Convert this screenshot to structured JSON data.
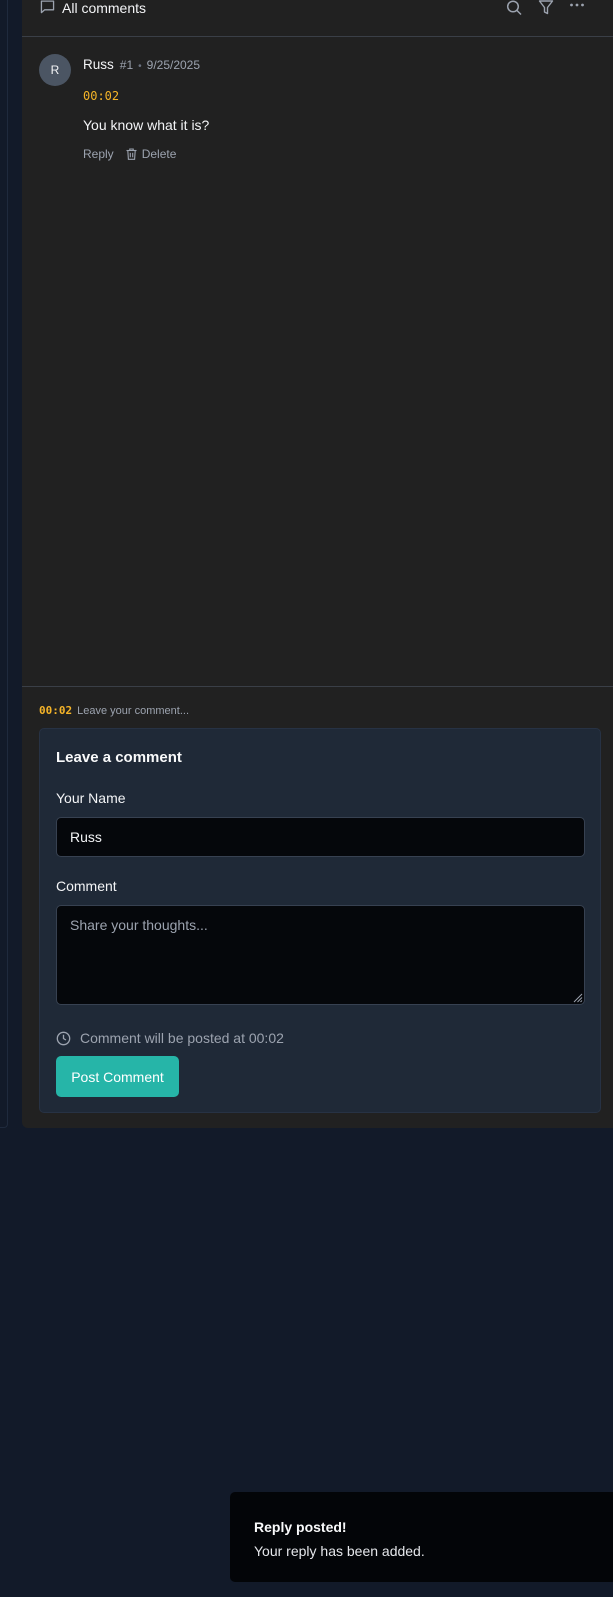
{
  "header": {
    "title": "All comments",
    "icons": [
      "chat-icon",
      "search-icon",
      "filter-icon",
      "more-icon"
    ]
  },
  "comments": [
    {
      "avatar_initial": "R",
      "author": "Russ",
      "number": "#1",
      "separator": "•",
      "date": "9/25/2025",
      "timestamp": "00:02",
      "text": "You know what it is?",
      "actions": {
        "reply": "Reply",
        "delete": "Delete"
      }
    }
  ],
  "composer": {
    "timestamp": "00:02",
    "hint": "Leave your comment...",
    "form": {
      "title": "Leave a comment",
      "name_label": "Your Name",
      "name_value": "Russ",
      "comment_label": "Comment",
      "comment_placeholder": "Share your thoughts...",
      "post_note": "Comment will be posted at 00:02",
      "submit_label": "Post Comment"
    }
  },
  "toast": {
    "title": "Reply posted!",
    "description": "Your reply has been added."
  },
  "colors": {
    "page_bg": "#121a29",
    "panel_bg": "#212121",
    "card_bg": "#1f2937",
    "accent": "#26b5a8",
    "timestamp": "#f5b428"
  }
}
